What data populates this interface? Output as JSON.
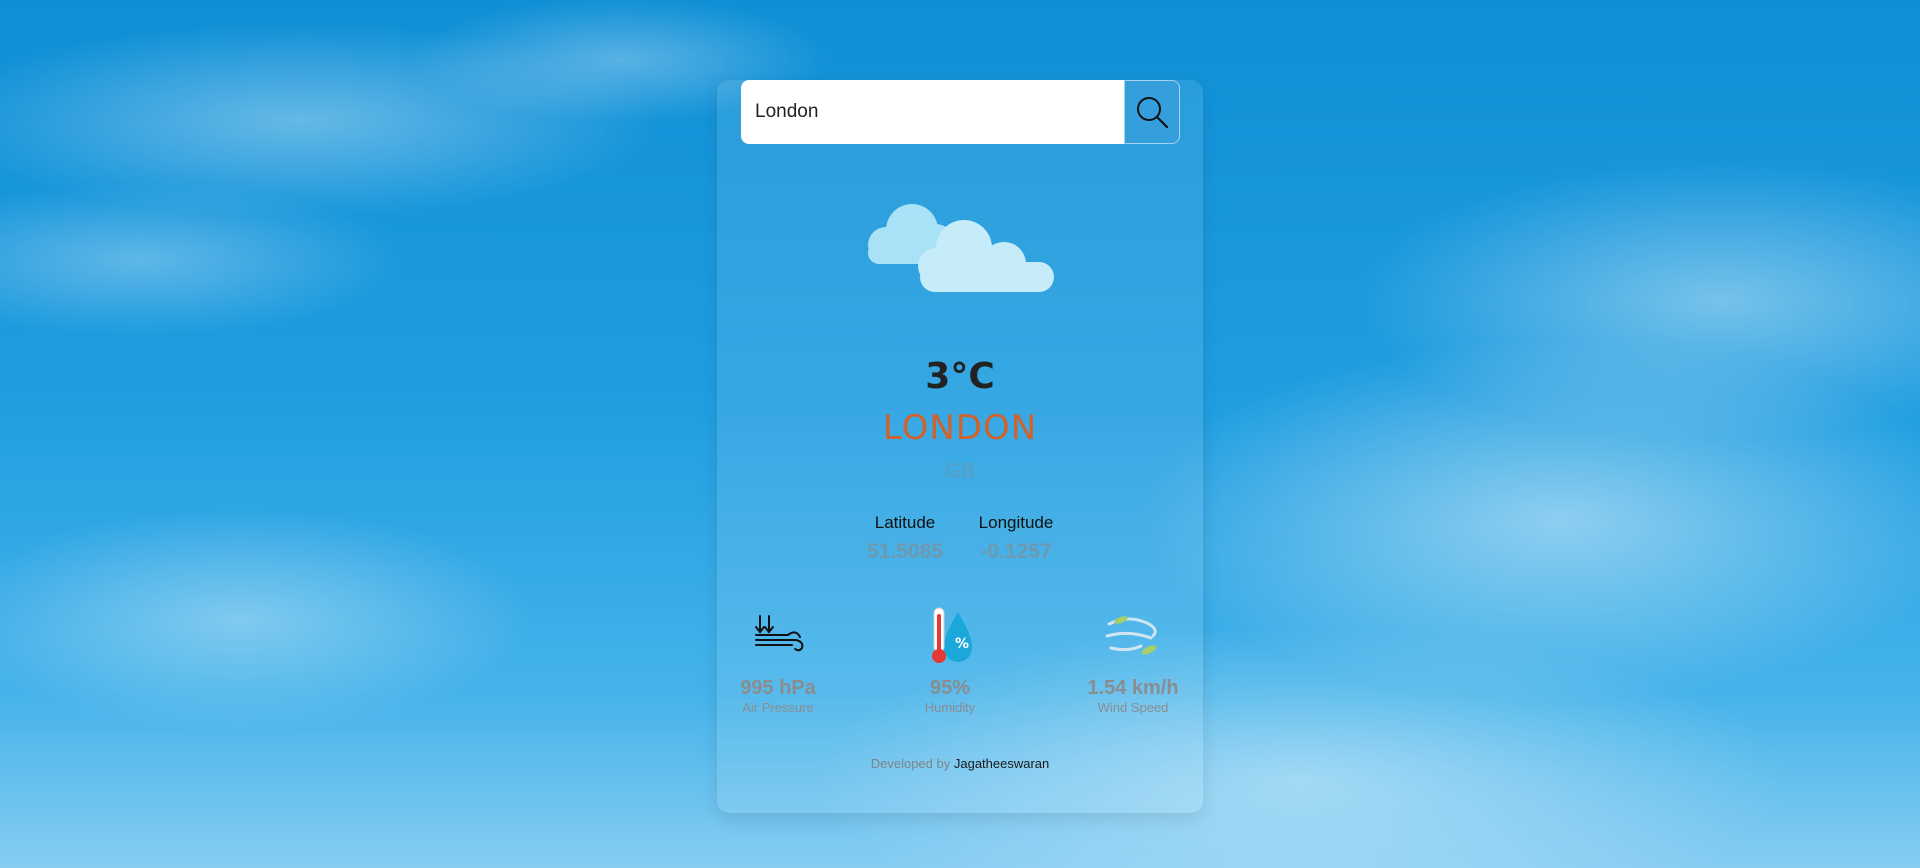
{
  "search": {
    "value": "London",
    "button_icon": "search-icon"
  },
  "weather": {
    "icon": "clouds-icon",
    "temperature": "3°C",
    "city": "LONDON",
    "country": "GB"
  },
  "coordinates": {
    "latitude_label": "Latitude",
    "latitude_value": "51.5085",
    "longitude_label": "Longitude",
    "longitude_value": "-0.1257"
  },
  "stats": {
    "pressure": {
      "value": "995 hPa",
      "label": "Air Pressure",
      "icon": "air-pressure-icon"
    },
    "humidity": {
      "value": "95%",
      "label": "Humidity",
      "icon": "humidity-icon"
    },
    "wind": {
      "value": "1.54 km/h",
      "label": "Wind Speed",
      "icon": "wind-icon"
    }
  },
  "footer": {
    "prefix": "Developed by",
    "author": "Jagatheeswaran"
  },
  "colors": {
    "city": "#d0622a",
    "muted": "#8a8d90",
    "sky": "#1f9de0"
  }
}
